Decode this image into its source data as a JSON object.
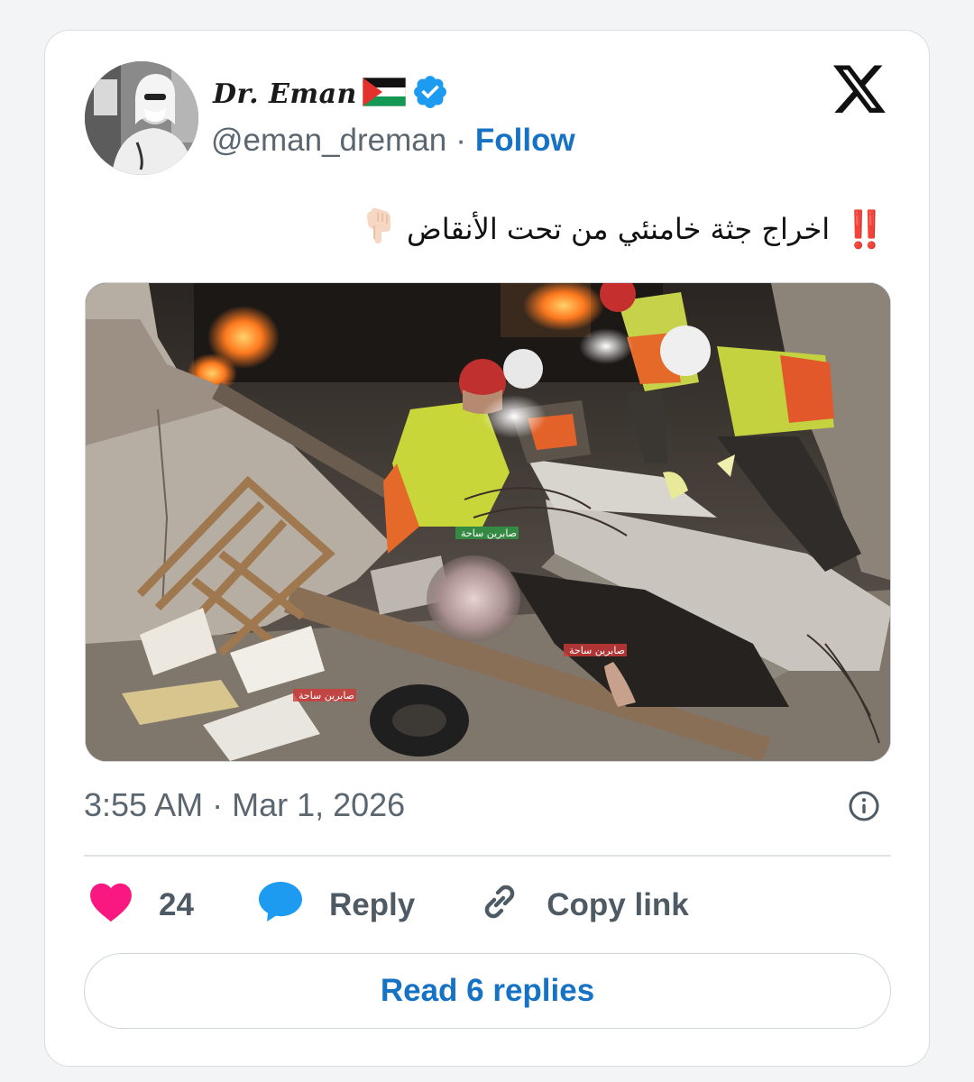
{
  "author": {
    "display_name": "Dr. Eman",
    "handle": "@eman_dreman",
    "separator": "·",
    "follow_label": "Follow",
    "flag_icon": "palestine-flag-icon",
    "verified_icon": "verified-badge-icon",
    "verified_color": "#1d9bf0"
  },
  "tweet": {
    "emphasis": "‼️",
    "text": "اخراج جثة خامنئي من تحت الأنقاض",
    "pointing_emoji": "👇🏻"
  },
  "media": {
    "watermarks": [
      "صابرين ساحة",
      "صابرين ساحة",
      "صابرين ساحة"
    ]
  },
  "meta": {
    "timestamp": "3:55 AM · Mar 1, 2026"
  },
  "actions": {
    "like_count": "24",
    "reply_label": "Reply",
    "copy_link_label": "Copy link"
  },
  "read_replies_label": "Read 6 replies",
  "colors": {
    "accent": "#1572c4",
    "like": "#f91880",
    "reply_icon": "#1d9bf0"
  }
}
